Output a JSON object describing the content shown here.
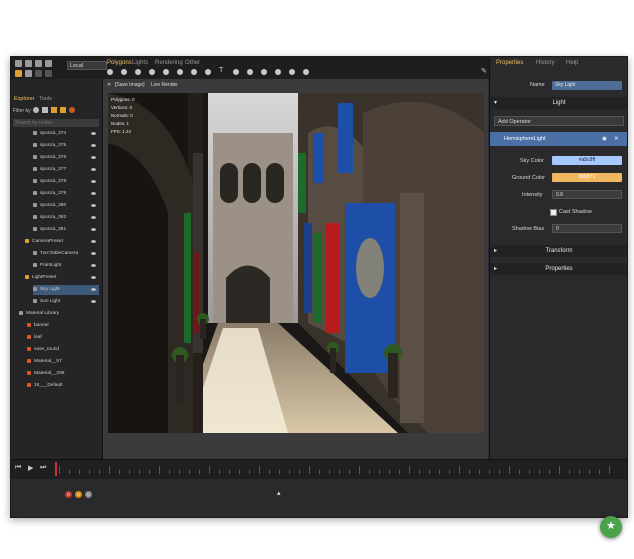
{
  "toolbar": {
    "space_select": "Local"
  },
  "menu_tabs": [
    "Polygons",
    "Lights",
    "Rendering",
    "Other"
  ],
  "left_panel": {
    "tabs": [
      "Explorer",
      "Tools"
    ],
    "filter_label": "Filter by",
    "search_placeholder": "Search by nodes",
    "tree": [
      {
        "label": "sponza_374",
        "type": "mesh"
      },
      {
        "label": "sponza_375",
        "type": "mesh"
      },
      {
        "label": "sponza_376",
        "type": "mesh"
      },
      {
        "label": "sponza_377",
        "type": "mesh"
      },
      {
        "label": "sponza_378",
        "type": "mesh"
      },
      {
        "label": "sponza_379",
        "type": "mesh"
      },
      {
        "label": "sponza_380",
        "type": "mesh"
      },
      {
        "label": "sponza_382",
        "type": "mesh"
      },
      {
        "label": "sponza_381",
        "type": "mesh"
      },
      {
        "label": "CameraPreset",
        "type": "group"
      },
      {
        "label": "TurnTableCamera",
        "type": "camera"
      },
      {
        "label": "PointLight",
        "type": "light"
      },
      {
        "label": "LightPreset",
        "type": "group"
      },
      {
        "label": "Sky Light",
        "type": "light"
      },
      {
        "label": "Sun Light",
        "type": "light"
      },
      {
        "label": "Material Library",
        "type": "library"
      },
      {
        "label": "banner",
        "type": "material"
      },
      {
        "label": "leaf",
        "type": "material"
      },
      {
        "label": "vase_round",
        "type": "material"
      },
      {
        "label": "Material__57",
        "type": "material"
      },
      {
        "label": "Material__298",
        "type": "material"
      },
      {
        "label": "16___Default",
        "type": "material"
      }
    ]
  },
  "viewport": {
    "save_label": "[Save Image]",
    "mode_label": "Live Render",
    "stats": [
      "Polygons: 0",
      "Vertices: 0",
      "Normals: 0",
      "Nodes: 1",
      "FPS: 1.24"
    ]
  },
  "right_panel": {
    "tabs": [
      "Properties",
      "History",
      "Help"
    ],
    "name_label": "Name",
    "name_value": "Sky Light",
    "section_light": "Light",
    "add_operator": "Add Operator",
    "operator_name": "HemisphereLight",
    "props": {
      "sky_color_label": "Sky Color",
      "sky_color_value": "#a5c9ff",
      "ground_color_label": "Ground Color",
      "ground_color_value": "#bb871",
      "intensity_label": "Intensity",
      "intensity_value": "0.8",
      "cast_shadow_label": "Cast Shadow",
      "shadow_bias_label": "Shadow Bias",
      "shadow_bias_value": "0"
    },
    "section_transform": "Transform",
    "section_properties": "Properties"
  },
  "bottom": {
    "badges": [
      "0",
      "0",
      "0"
    ]
  },
  "colors": {
    "accent": "#e0a030",
    "selection": "#3d5a7a",
    "sky_swatch": "#a5c9ff",
    "ground_swatch": "#f0b760",
    "operator_bg": "#4a6fa5"
  }
}
